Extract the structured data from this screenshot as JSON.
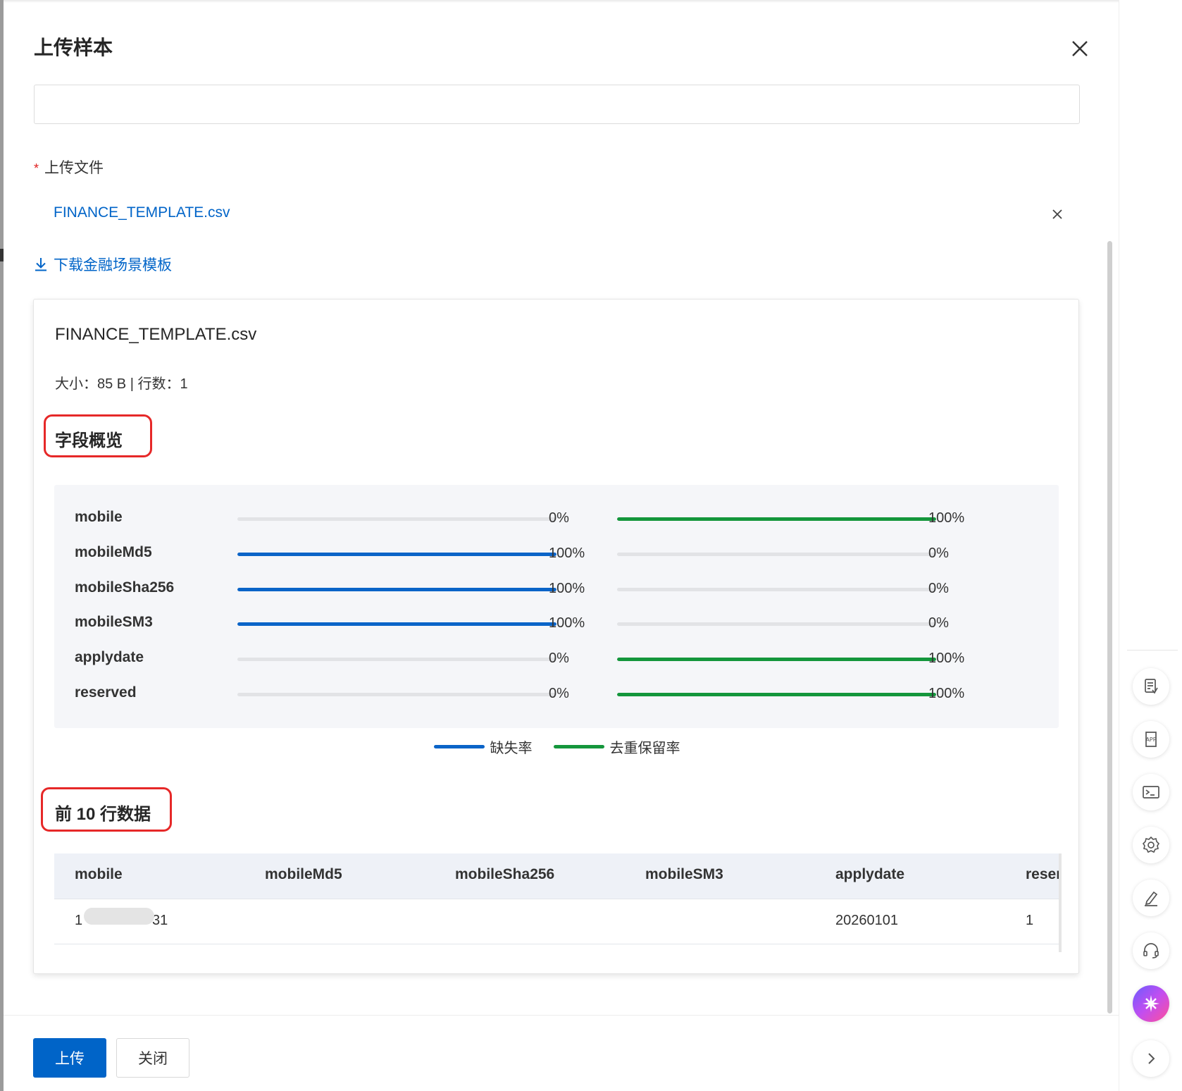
{
  "dialog": {
    "title": "上传样本",
    "upload_field_label": "上传文件",
    "required_mark": "*",
    "uploaded_file": "FINANCE_TEMPLATE.csv",
    "download_template": "下载金融场景模板"
  },
  "file_card": {
    "name": "FINANCE_TEMPLATE.csv",
    "meta": "大小：85 B | 行数：1",
    "overview_title": "字段概览",
    "fields": [
      {
        "name": "mobile",
        "missing_rate": 0,
        "missing_label": "0%",
        "dedup_rate": 100,
        "dedup_label": "100%"
      },
      {
        "name": "mobileMd5",
        "missing_rate": 100,
        "missing_label": "100%",
        "dedup_rate": 0,
        "dedup_label": "0%"
      },
      {
        "name": "mobileSha256",
        "missing_rate": 100,
        "missing_label": "100%",
        "dedup_rate": 0,
        "dedup_label": "0%"
      },
      {
        "name": "mobileSM3",
        "missing_rate": 100,
        "missing_label": "100%",
        "dedup_rate": 0,
        "dedup_label": "0%"
      },
      {
        "name": "applydate",
        "missing_rate": 0,
        "missing_label": "0%",
        "dedup_rate": 100,
        "dedup_label": "100%"
      },
      {
        "name": "reserved",
        "missing_rate": 0,
        "missing_label": "0%",
        "dedup_rate": 100,
        "dedup_label": "100%"
      }
    ],
    "legend": {
      "missing": "缺失率",
      "dedup": "去重保留率"
    },
    "preview_title": "前 10 行数据",
    "table": {
      "columns": [
        "mobile",
        "mobileMd5",
        "mobileSha256",
        "mobileSM3",
        "applydate",
        "reser"
      ],
      "rows": [
        {
          "mobile_prefix": "1",
          "mobile_suffix": "31",
          "mobileMd5": "",
          "mobileSha256": "",
          "mobileSM3": "",
          "applydate": "20260101",
          "reserved": "1"
        }
      ]
    }
  },
  "footer": {
    "upload": "上传",
    "close": "关闭"
  },
  "colors": {
    "primary": "#0064c8",
    "missing_bar": "#0a64c8",
    "dedup_bar": "#14963c",
    "highlight": "#e62828"
  },
  "right_rail": {
    "icons": [
      "document-list-icon",
      "app-icon",
      "terminal-icon",
      "gear-icon",
      "pen-icon",
      "headset-icon",
      "ai-assistant-icon",
      "chevron-right-icon"
    ]
  }
}
